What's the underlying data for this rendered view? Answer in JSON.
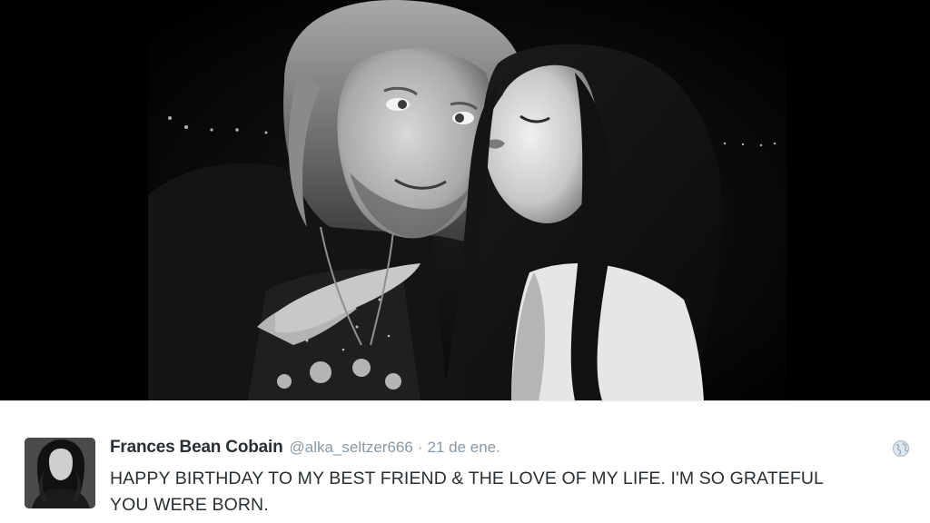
{
  "tweet": {
    "author_name": "Frances Bean Cobain",
    "handle": "@alka_seltzer666",
    "separator": "·",
    "date": "21 de ene.",
    "text": "HAPPY BIRTHDAY TO MY BEST FRIEND & THE LOVE OF MY LIFE. I'M SO GRATEFUL YOU WERE BORN."
  },
  "icons": {
    "globe": "globe-icon"
  },
  "colors": {
    "name": "#292f33",
    "meta": "#8899a6",
    "photo_background": "#000000"
  }
}
